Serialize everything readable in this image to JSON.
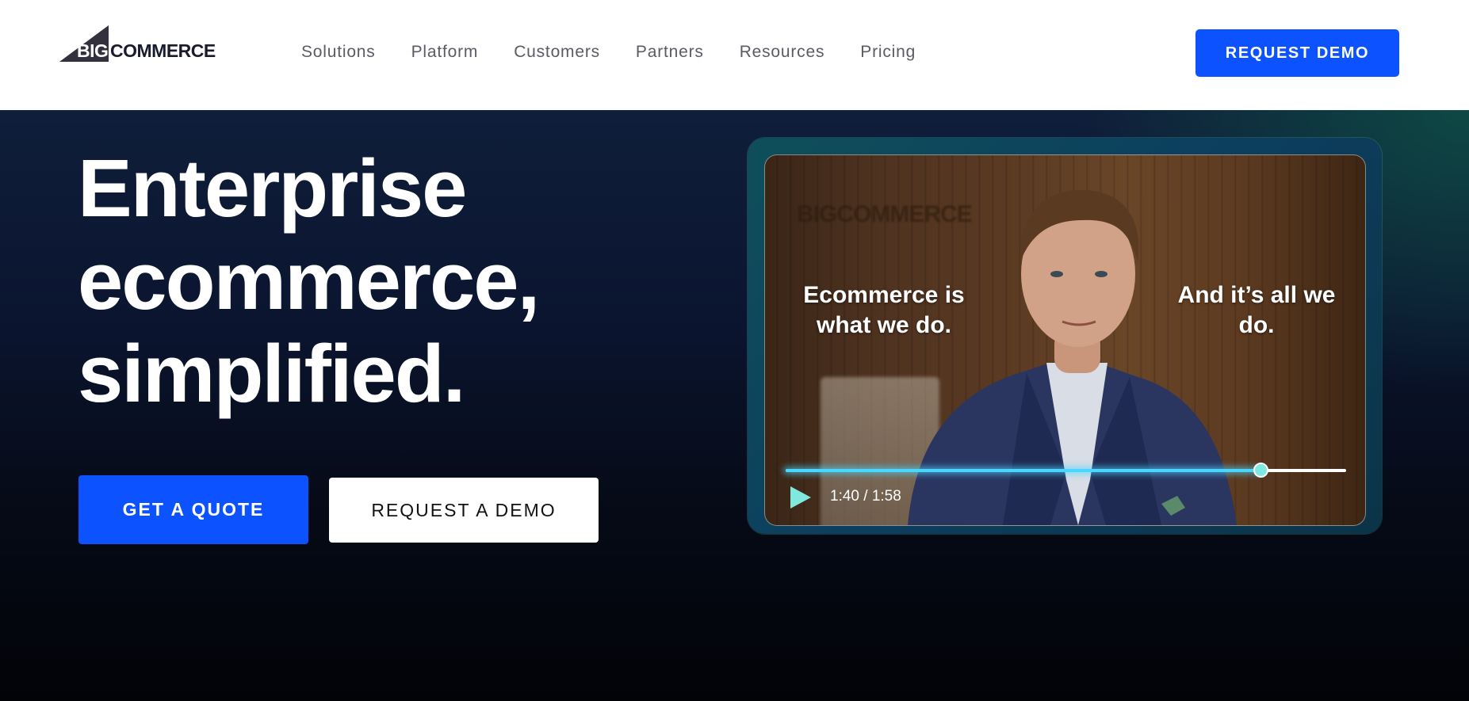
{
  "header": {
    "logo": {
      "big": "BIG",
      "commerce": "COMMERCE"
    },
    "nav": [
      {
        "label": "Solutions"
      },
      {
        "label": "Platform"
      },
      {
        "label": "Customers"
      },
      {
        "label": "Partners"
      },
      {
        "label": "Resources"
      },
      {
        "label": "Pricing"
      }
    ],
    "cta_label": "REQUEST DEMO"
  },
  "hero": {
    "title_lines": [
      "Enterprise",
      "ecommerce,",
      "simplified."
    ],
    "quote_label": "GET A QUOTE",
    "demo_label": "REQUEST A DEMO"
  },
  "video": {
    "caption_left": "Ecommerce is what we do.",
    "caption_right": "And it’s all we do.",
    "time": "1:40 / 1:58",
    "progress": 0.8475,
    "wall_logo": "BIGCOMMERCE"
  },
  "colors": {
    "brand_blue": "#0d52ff",
    "progress_accent": "#4ad6ff",
    "play_accent": "#7fe9e0"
  },
  "icons": {
    "logo": "bigcommerce-triangle-icon",
    "play": "play-icon"
  }
}
